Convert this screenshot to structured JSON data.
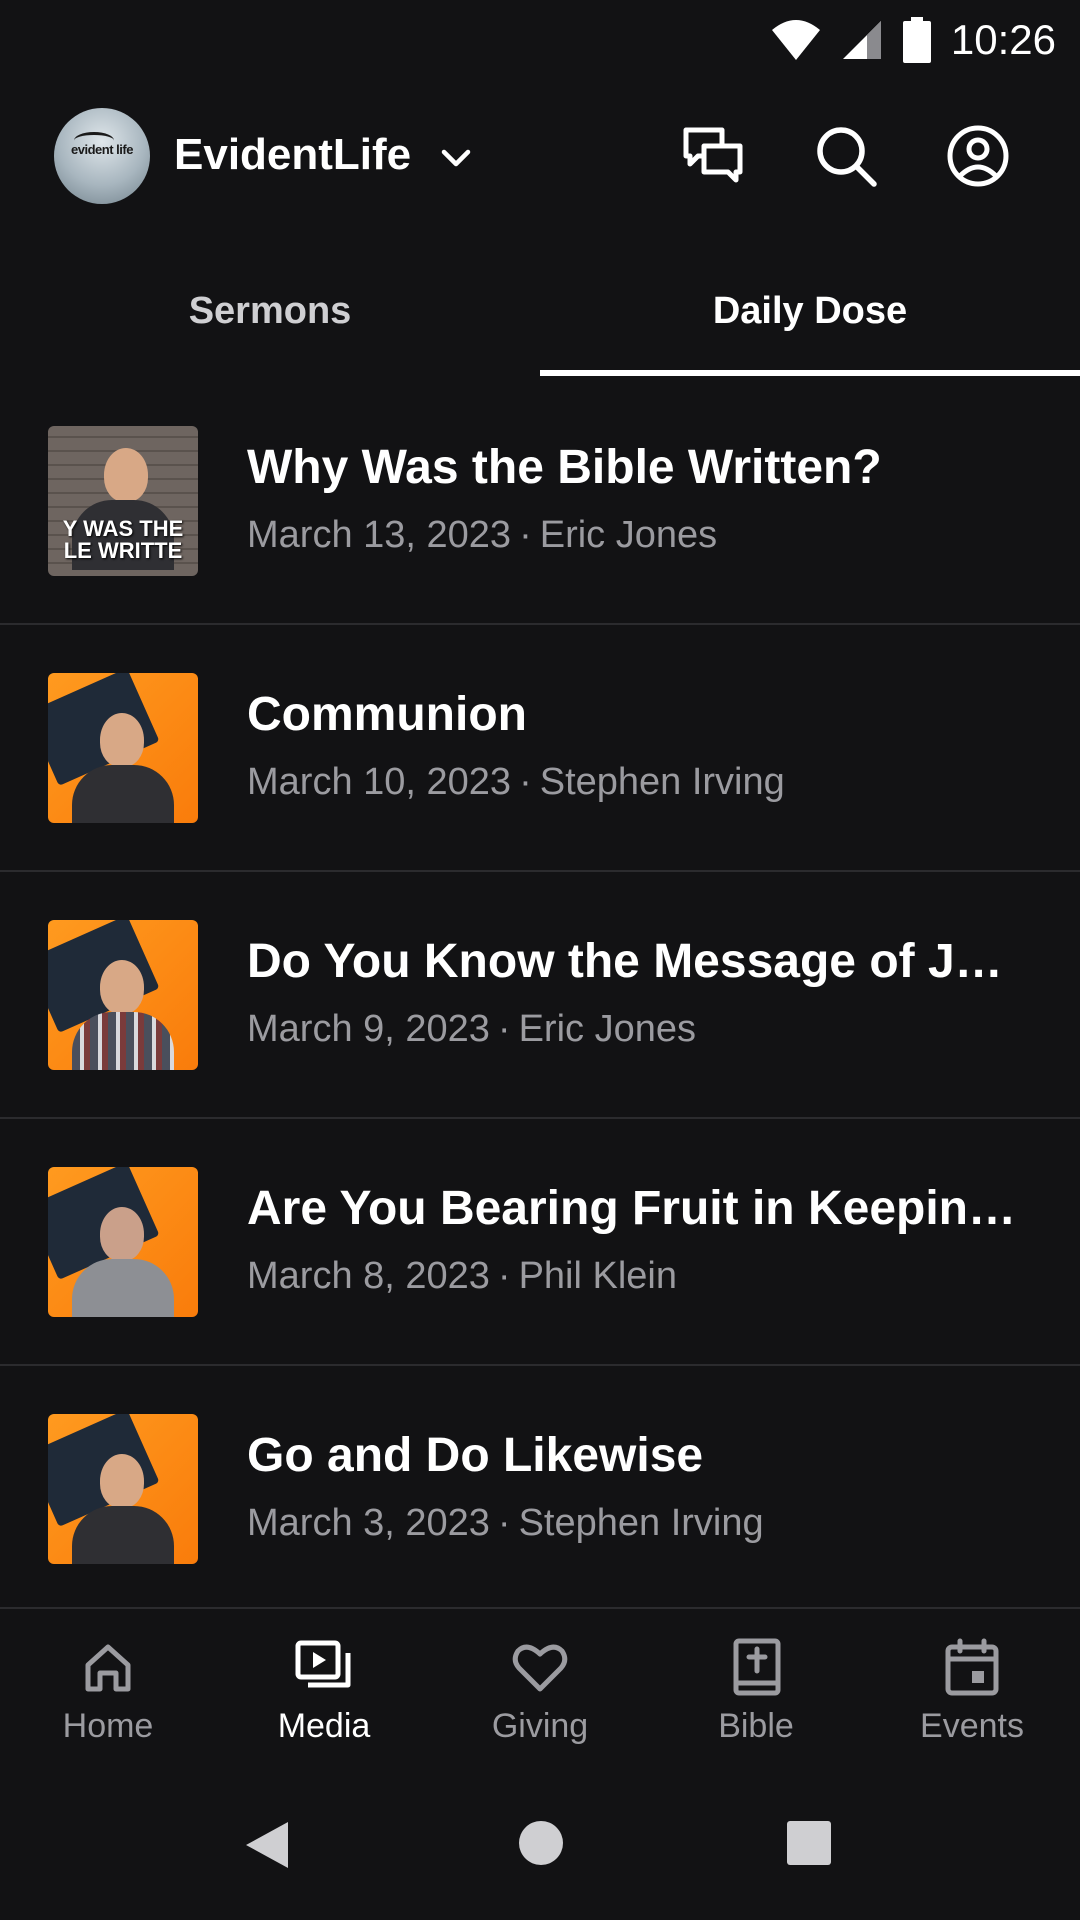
{
  "status_bar": {
    "time": "10:26"
  },
  "header": {
    "church_name": "EvidentLife",
    "logo_text": "evident life"
  },
  "tabs": [
    {
      "label": "Sermons",
      "active": false
    },
    {
      "label": "Daily Dose",
      "active": true
    }
  ],
  "media_items": [
    {
      "title": "Why Was the Bible Written?",
      "date": "March 13, 2023",
      "author": "Eric Jones",
      "thumb_caption": "Y WAS THE LE WRITTE"
    },
    {
      "title": "Communion",
      "date": "March 10, 2023",
      "author": "Stephen Irving"
    },
    {
      "title": "Do You Know the Message of Je…",
      "date": "March 9, 2023",
      "author": "Eric Jones"
    },
    {
      "title": "Are You Bearing Fruit in Keeping…",
      "date": "March 8, 2023",
      "author": "Phil Klein"
    },
    {
      "title": "Go and Do Likewise",
      "date": "March 3, 2023",
      "author": "Stephen Irving"
    }
  ],
  "meta_separator": "·",
  "bottom_nav": [
    {
      "label": "Home",
      "icon": "home-icon",
      "active": false
    },
    {
      "label": "Media",
      "icon": "media-icon",
      "active": true
    },
    {
      "label": "Giving",
      "icon": "heart-icon",
      "active": false
    },
    {
      "label": "Bible",
      "icon": "bible-icon",
      "active": false
    },
    {
      "label": "Events",
      "icon": "calendar-icon",
      "active": false
    }
  ],
  "colors": {
    "background": "#121214",
    "text_primary": "#ffffff",
    "text_secondary": "#9b9ba0",
    "divider": "#2b2b2e",
    "thumbnail_orange": "#f97c0b"
  }
}
